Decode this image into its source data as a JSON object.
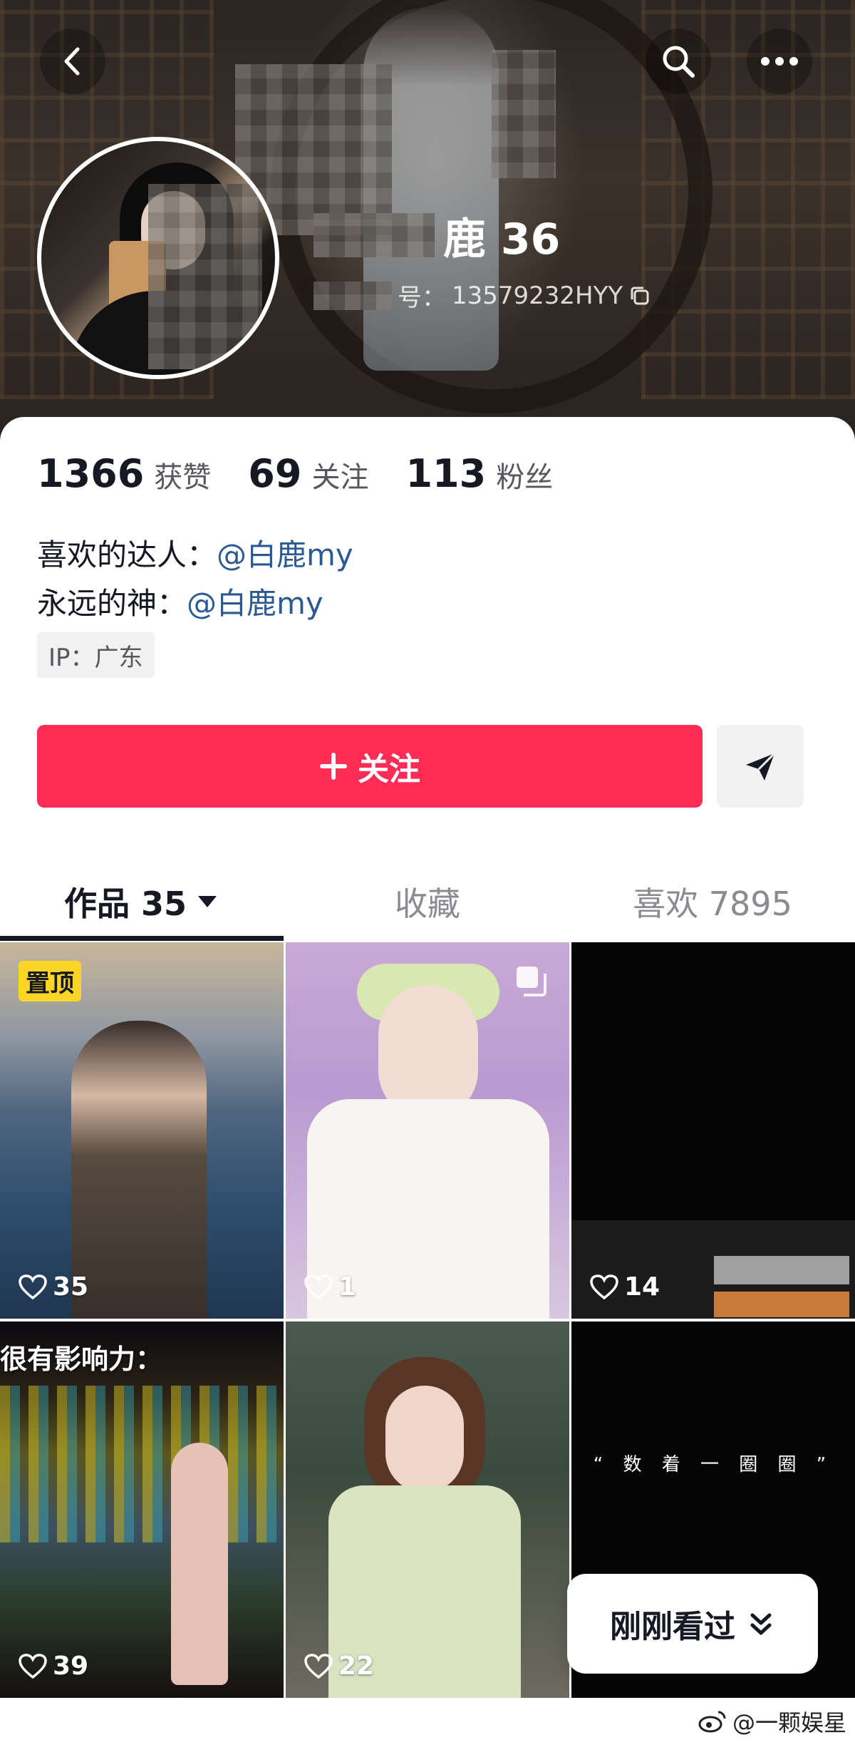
{
  "header": {
    "nickname_visible": "鹿 36",
    "douyin_id_label": "号：",
    "douyin_id": "13579232HYY"
  },
  "stats": [
    {
      "value": "1366",
      "label": "获赞"
    },
    {
      "value": "69",
      "label": "关注"
    },
    {
      "value": "113",
      "label": "粉丝"
    }
  ],
  "bio": {
    "line1_prefix": "喜欢的达人：",
    "line1_mention": "@白鹿my",
    "line2_prefix": "永远的神：",
    "line2_mention": "@白鹿my"
  },
  "ip_tag": "IP：广东",
  "actions": {
    "follow_label": "关注",
    "follow_icon": "plus-icon",
    "share_icon": "send-icon"
  },
  "tabs": [
    {
      "label": "作品 35",
      "active": true
    },
    {
      "label": "收藏",
      "active": false
    },
    {
      "label": "喜欢 7895",
      "active": false
    }
  ],
  "videos": [
    {
      "likes": "35",
      "pinned_label": "置顶"
    },
    {
      "likes": "1"
    },
    {
      "likes": "14"
    },
    {
      "likes": "39",
      "overlay_text": "很有影响力："
    },
    {
      "likes": "22"
    },
    {
      "likes": "",
      "overlay_text": "“ 数 着 一 圈 圈 ”"
    }
  ],
  "recent_button": "刚刚看过",
  "watermark": "@一颗娱星",
  "colors": {
    "accent": "#fe2c55",
    "mention": "#2b5a93",
    "pin": "#fdd524"
  }
}
